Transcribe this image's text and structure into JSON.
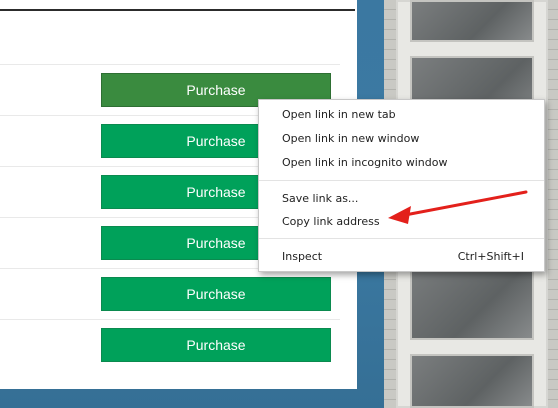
{
  "purchase_buttons": [
    {
      "label": "Purchase"
    },
    {
      "label": "Purchase"
    },
    {
      "label": "Purchase"
    },
    {
      "label": "Purchase"
    },
    {
      "label": "Purchase"
    },
    {
      "label": "Purchase"
    }
  ],
  "context_menu": {
    "items": [
      {
        "label": "Open link in new tab"
      },
      {
        "label": "Open link in new window"
      },
      {
        "label": "Open link in incognito window"
      },
      {
        "label": "Save link as..."
      },
      {
        "label": "Copy link address"
      },
      {
        "label": "Inspect",
        "shortcut": "Ctrl+Shift+I"
      }
    ]
  },
  "colors": {
    "button_green": "#00a15a",
    "button_hover_green": "#3a8b3f",
    "annotation_arrow": "#e3201b",
    "background_blue": "#3b78a1"
  }
}
